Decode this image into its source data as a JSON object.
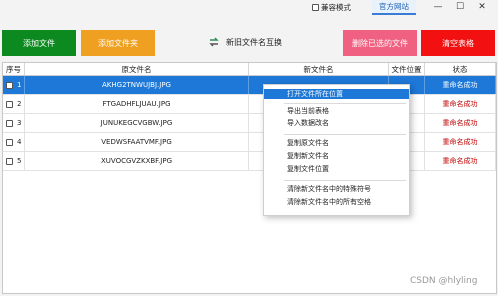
{
  "window": {
    "compat_label": "兼容模式",
    "official_site": "官方网站",
    "minimize_glyph": "—",
    "maximize_glyph": "☐",
    "close_glyph": "✕"
  },
  "toolbar": {
    "add_files": "添加文件",
    "add_folder": "添加文件夹",
    "swap_names": "新旧文件名互换",
    "delete_selected": "删除已选的文件",
    "clear_table": "清空表格",
    "colors": {
      "add_files": "#0c8a1f",
      "add_folder": "#f0a020",
      "delete_selected": "#f06080",
      "clear_table": "#f31010"
    }
  },
  "table": {
    "columns": [
      "序号",
      "原文件名",
      "新文件名",
      "文件位置",
      "状态"
    ],
    "rows": [
      {
        "index": "1",
        "original": "AKHG2TNWUJBJ.JPG",
        "new": "",
        "location": "",
        "status": "重命名成功",
        "selected": true
      },
      {
        "index": "2",
        "original": "FTGADHFLJUAU.JPG",
        "new": "",
        "location": "",
        "status": "重命名成功",
        "selected": false
      },
      {
        "index": "3",
        "original": "JUNUKEGCVGBW.JPG",
        "new": "",
        "location": "",
        "status": "重命名成功",
        "selected": false
      },
      {
        "index": "4",
        "original": "VEDWSFAATVMF.JPG",
        "new": "",
        "location": "",
        "status": "重命名成功",
        "selected": false
      },
      {
        "index": "5",
        "original": "XUVOCGVZKXBF.JPG",
        "new": "",
        "location": "",
        "status": "重命名成功",
        "selected": false
      }
    ]
  },
  "context_menu": {
    "items": [
      "打开文件所在位置",
      "导出当前表格",
      "导入数据改名",
      "复制原文件名",
      "复制新文件名",
      "复制文件位置",
      "清除新文件名中的特殊符号",
      "清除新文件名中的所有空格"
    ],
    "highlighted": "打开文件所在位置"
  },
  "watermark": "CSDN @hlyling"
}
